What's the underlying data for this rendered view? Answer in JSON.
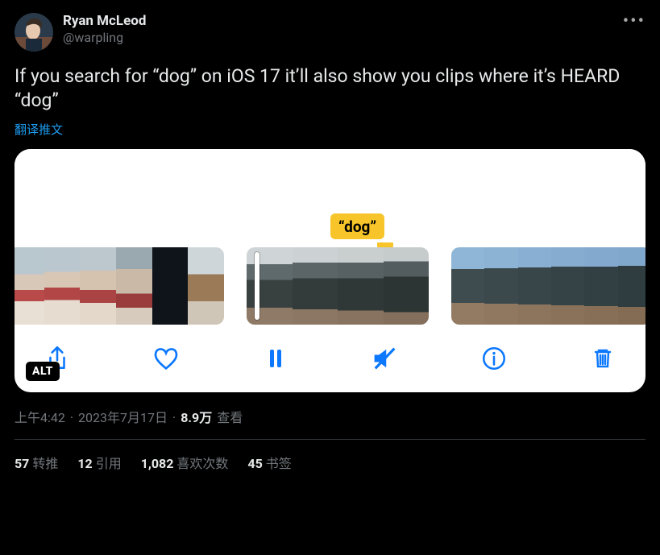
{
  "author": {
    "name": "Ryan McLeod",
    "handle": "@warpling"
  },
  "text": "If you search for “dog” on iOS 17 it’ll also show you clips where it’s HEARD “dog”",
  "translate_label": "翻译推文",
  "media": {
    "tag": "“dog”",
    "alt_badge": "ALT"
  },
  "meta": {
    "time": "上午4:42",
    "dot1": "·",
    "date": "2023年7月17日",
    "dot2": "·",
    "views_count": "8.9万",
    "views_label": "查看"
  },
  "stats": {
    "retweets_count": "57",
    "retweets_label": "转推",
    "quotes_count": "12",
    "quotes_label": "引用",
    "likes_count": "1,082",
    "likes_label": "喜欢次数",
    "bookmarks_count": "45",
    "bookmarks_label": "书签"
  }
}
